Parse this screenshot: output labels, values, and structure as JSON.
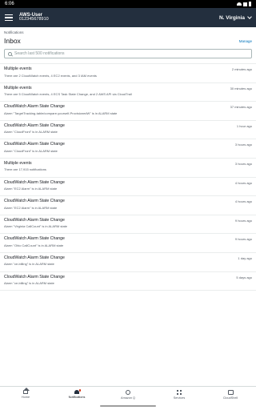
{
  "status_bar": {
    "time": "6:06"
  },
  "app_bar": {
    "user": "AWS-User",
    "account_id": "012345678910",
    "region": "N. Virginia"
  },
  "breadcrumb": "Notifications",
  "page_title": "Inbox",
  "manage_label": "Manage",
  "search": {
    "placeholder": "Search last 500 notifications"
  },
  "notifications": [
    {
      "title": "Multiple events",
      "time": "2 minutes ago",
      "desc": "There are 2 CloudWatch events, 4 EC2 events, and 3 IAM events"
    },
    {
      "title": "Multiple events",
      "time": "30 minutes ago",
      "desc": "There are 5 CloudWatch events, 4 ECS Task State Change, and 2 AWS API via CloudTrail"
    },
    {
      "title": "CloudWatch Alarm State Change",
      "time": "37 minutes ago",
      "desc": "Alarm \"TargetTracking-table/compare-yourself-ProvisionedW\" is in ALARM state"
    },
    {
      "title": "CloudWatch Alarm State Change",
      "time": "1 hour ago",
      "desc": "Alarm \"CloudFront\" is in ALARM state"
    },
    {
      "title": "CloudWatch Alarm State Change",
      "time": "3 hours ago",
      "desc": "Alarm \"CloudFront\" is in ALARM state"
    },
    {
      "title": "Multiple events",
      "time": "3 hours ago",
      "desc": "There are 17,915 notifications"
    },
    {
      "title": "CloudWatch Alarm State Change",
      "time": "4 hours ago",
      "desc": "Alarm \"EC2 Alarm\" is in ALARM state"
    },
    {
      "title": "CloudWatch Alarm State Change",
      "time": "4 hours ago",
      "desc": "Alarm \"EC2 Alarm\" is in ALARM state"
    },
    {
      "title": "CloudWatch Alarm State Change",
      "time": "9 hours ago",
      "desc": "Alarm \"Virginia CallCount\" is in ALARM state"
    },
    {
      "title": "CloudWatch Alarm State Change",
      "time": "9 hours ago",
      "desc": "Alarm \"Ohio CallCount\" is in ALARM state"
    },
    {
      "title": "CloudWatch Alarm State Change",
      "time": "1 day ago",
      "desc": "Alarm \"ce-billing\" is in ALARM state"
    },
    {
      "title": "CloudWatch Alarm State Change",
      "time": "5 days ago",
      "desc": "Alarm \"ce-billing\" is in ALARM state"
    }
  ],
  "bottom_nav": [
    {
      "label": "Home",
      "icon": "home-icon"
    },
    {
      "label": "Notifications",
      "icon": "bell-icon"
    },
    {
      "label": "Amazon Q",
      "icon": "amazon-q-icon"
    },
    {
      "label": "Services",
      "icon": "grid-icon"
    },
    {
      "label": "CloudShell",
      "icon": "terminal-icon"
    }
  ]
}
